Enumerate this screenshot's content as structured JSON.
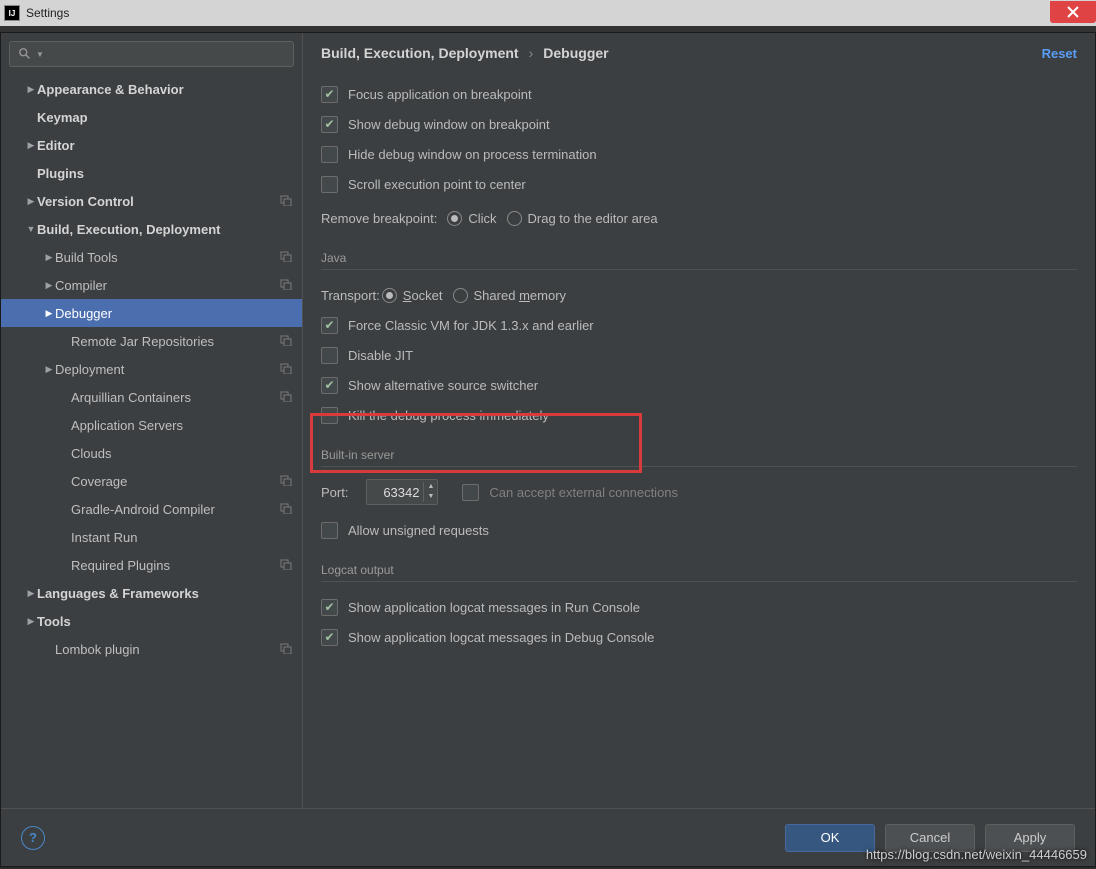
{
  "window": {
    "title": "Settings"
  },
  "search": {
    "placeholder": ""
  },
  "sidebar": [
    {
      "label": "Appearance & Behavior",
      "depth": 0,
      "arrow": "right",
      "bold": true
    },
    {
      "label": "Keymap",
      "depth": 0,
      "arrow": "",
      "bold": true
    },
    {
      "label": "Editor",
      "depth": 0,
      "arrow": "right",
      "bold": true
    },
    {
      "label": "Plugins",
      "depth": 0,
      "arrow": "",
      "bold": true
    },
    {
      "label": "Version Control",
      "depth": 0,
      "arrow": "right",
      "bold": true,
      "badge": true
    },
    {
      "label": "Build, Execution, Deployment",
      "depth": 0,
      "arrow": "down",
      "bold": true
    },
    {
      "label": "Build Tools",
      "depth": 1,
      "arrow": "right",
      "badge": true
    },
    {
      "label": "Compiler",
      "depth": 1,
      "arrow": "right",
      "badge": true
    },
    {
      "label": "Debugger",
      "depth": 1,
      "arrow": "right",
      "selected": true
    },
    {
      "label": "Remote Jar Repositories",
      "depth": 2,
      "badge": true
    },
    {
      "label": "Deployment",
      "depth": 1,
      "arrow": "right",
      "badge": true
    },
    {
      "label": "Arquillian Containers",
      "depth": 2,
      "badge": true
    },
    {
      "label": "Application Servers",
      "depth": 2
    },
    {
      "label": "Clouds",
      "depth": 2
    },
    {
      "label": "Coverage",
      "depth": 2,
      "badge": true
    },
    {
      "label": "Gradle-Android Compiler",
      "depth": 2,
      "badge": true
    },
    {
      "label": "Instant Run",
      "depth": 2
    },
    {
      "label": "Required Plugins",
      "depth": 2,
      "badge": true
    },
    {
      "label": "Languages & Frameworks",
      "depth": 0,
      "arrow": "right",
      "bold": true
    },
    {
      "label": "Tools",
      "depth": 0,
      "arrow": "right",
      "bold": true
    },
    {
      "label": "Lombok plugin",
      "depth": 1,
      "badge": true
    }
  ],
  "breadcrumb": {
    "parent": "Build, Execution, Deployment",
    "current": "Debugger",
    "reset": "Reset"
  },
  "main": {
    "focus_app": "Focus application on breakpoint",
    "show_debug_pre": "Show ",
    "show_debug_u": "d",
    "show_debug_post": "ebug window on breakpoint",
    "hide_debug_pre": "Hide debug ",
    "hide_debug_u": "w",
    "hide_debug_post": "indow on process termination",
    "scroll_center": "Scroll execution point to center",
    "remove_bp": "Remove breakpoint:",
    "click": "Click",
    "drag": "Drag to the editor area"
  },
  "java": {
    "title": "Java",
    "transport": "Transport:",
    "s": "S",
    "socket": "ocket",
    "shared_pre": "Shared ",
    "m": "m",
    "shared_post": "emory",
    "force": "Force Classic VM for JDK 1.3.x and earlier",
    "disable_pre": "Disable ",
    "disable_u": "J",
    "disable_post": "IT",
    "alt": "Show alternative source switcher",
    "kill": "Kill the debug process immediately"
  },
  "server": {
    "title": "Built-in server",
    "port_u": "P",
    "port": "ort:",
    "port_value": "63342",
    "accept_pre": "Can accept ",
    "accept_u": "e",
    "accept_post": "xternal connections",
    "allow_u": "A",
    "allow": "llow unsigned requests"
  },
  "logcat": {
    "title": "Logcat output",
    "run": "Show application logcat messages in Run Console",
    "debug": "Show application logcat messages in Debug Console"
  },
  "footer": {
    "ok": "OK",
    "cancel": "Cancel",
    "apply": "Apply"
  },
  "watermark": "https://blog.csdn.net/weixin_44446659"
}
